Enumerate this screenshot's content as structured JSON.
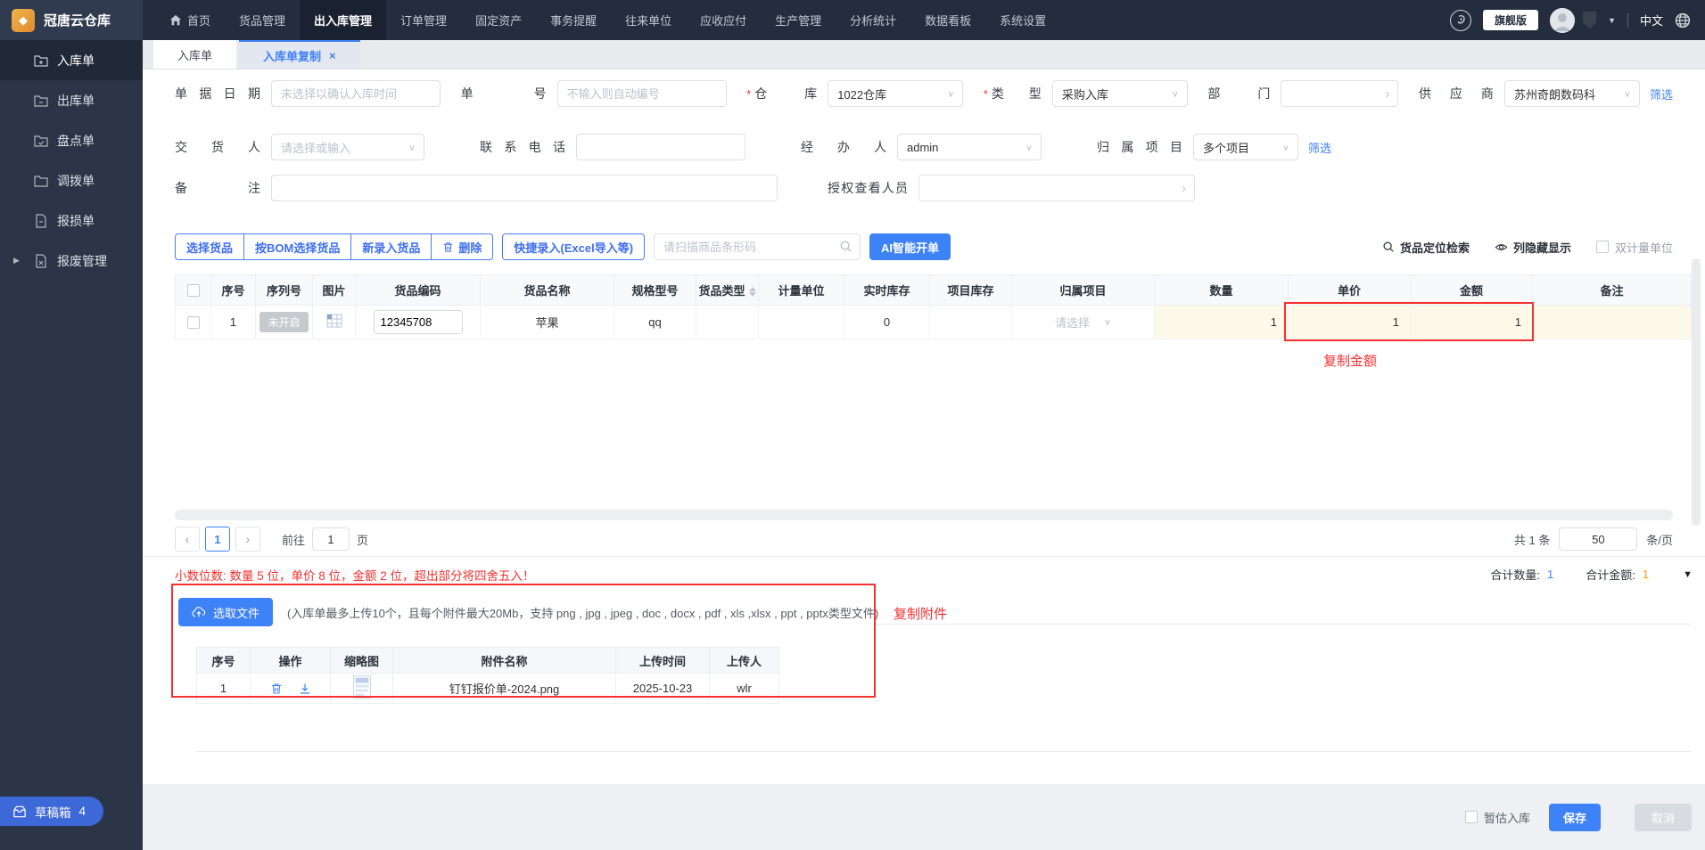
{
  "colors": {
    "accent": "#3e82f7",
    "danger": "#f53030",
    "warning": "#ff9900",
    "topbar": "#242d3d",
    "sidebar": "#2b3547"
  },
  "topbar": {
    "app_title": "冠唐云仓库",
    "menu": [
      {
        "label": "首页"
      },
      {
        "label": "货品管理"
      },
      {
        "label": "出入库管理"
      },
      {
        "label": "订单管理"
      },
      {
        "label": "固定资产"
      },
      {
        "label": "事务提醒"
      },
      {
        "label": "往来单位"
      },
      {
        "label": "应收应付"
      },
      {
        "label": "生产管理"
      },
      {
        "label": "分析统计"
      },
      {
        "label": "数据看板"
      },
      {
        "label": "系统设置"
      }
    ],
    "active_menu": "出入库管理",
    "edition_badge": "旗舰版",
    "language": "中文"
  },
  "sidebar": {
    "active": "入库单",
    "items": [
      {
        "label": "入库单"
      },
      {
        "label": "出库单"
      },
      {
        "label": "盘点单"
      },
      {
        "label": "调拨单"
      },
      {
        "label": "报损单"
      },
      {
        "label": "报废管理"
      }
    ]
  },
  "tabs": {
    "active": "入库单复制",
    "items": [
      {
        "label": "入库单"
      },
      {
        "label": "入库单复制"
      }
    ],
    "close_glyph": "×"
  },
  "form": {
    "bill_date": {
      "label": "单据日期",
      "placeholder": "未选择以确认入库时间"
    },
    "bill_no": {
      "label": "单号",
      "placeholder": "不输入则自动编号"
    },
    "warehouse": {
      "label": "仓库",
      "value": "1022仓库",
      "required": "*"
    },
    "type": {
      "label": "类型",
      "value": "采购入库",
      "required": "*"
    },
    "department": {
      "label": "部门",
      "value": ""
    },
    "supplier": {
      "label": "供应商",
      "value": "苏州奇朗数码科",
      "filter_link": "筛选"
    },
    "deliverer": {
      "label": "交货人",
      "placeholder": "请选择或输入"
    },
    "phone": {
      "label": "联系电话",
      "value": ""
    },
    "operator": {
      "label": "经办人",
      "value": "admin"
    },
    "project": {
      "label": "归属项目",
      "value": "多个项目",
      "filter_link": "筛选"
    },
    "remark": {
      "label": "备注",
      "value": ""
    },
    "authorized": {
      "label": "授权查看人员",
      "value": ""
    }
  },
  "toolbar": {
    "select_goods": "选择货品",
    "select_by_bom": "按BOM选择货品",
    "new_goods": "新录入货品",
    "delete": "删除",
    "quick_entry": "快捷录入(Excel导入等)",
    "scan_placeholder": "请扫描商品条形码",
    "ai_create": "AI智能开单",
    "locate_search": "货品定位检索",
    "column_toggle": "列隐藏显示",
    "dual_unit": "双计量单位"
  },
  "goods_table": {
    "columns": [
      "序号",
      "序列号",
      "图片",
      "货品编码",
      "货品名称",
      "规格型号",
      "货品类型",
      "计量单位",
      "实时库存",
      "项目库存",
      "归属项目",
      "数量",
      "单价",
      "金额",
      "备注"
    ],
    "rows": [
      {
        "seq": "1",
        "serial_status": "未开启",
        "code": "12345708",
        "name": "苹果",
        "spec": "qq",
        "type": "",
        "unit": "",
        "stock": "0",
        "project_stock": "",
        "project_placeholder": "请选择",
        "qty": "1",
        "price": "1",
        "amount": "1",
        "remark": ""
      }
    ]
  },
  "pagination": {
    "prev": "‹",
    "next": "›",
    "page": "1",
    "goto_label": "前往",
    "goto_value": "1",
    "page_unit": "页",
    "total_label": "共 1 条",
    "page_size": "50",
    "size_unit": "条/页"
  },
  "notes": {
    "decimals": "小数位数: 数量 5 位，单价 8 位，金额 2 位，超出部分将四舍五入！"
  },
  "totals": {
    "qty_label": "合计数量:",
    "qty_value": "1",
    "amount_label": "合计金额:",
    "amount_value": "1"
  },
  "upload": {
    "button": "选取文件",
    "hint": "(入库单最多上传10个，且每个附件最大20Mb，支持 png , jpg , jpeg , doc , docx , pdf , xls ,xlsx , ppt , pptx类型文件)"
  },
  "attachments": {
    "columns": [
      "序号",
      "操作",
      "缩略图",
      "附件名称",
      "上传时间",
      "上传人"
    ],
    "rows": [
      {
        "seq": "1",
        "name": "钉钉报价单-2024.png",
        "date": "2025-10-23",
        "uploader": "wlr"
      }
    ]
  },
  "annotations": {
    "copy_amount": "复制金额",
    "copy_attachment": "复制附件"
  },
  "footer": {
    "estimate": "暂估入库",
    "save": "保存",
    "cancel": "取消"
  },
  "draftbox": {
    "label": "草稿箱",
    "count": "4"
  }
}
